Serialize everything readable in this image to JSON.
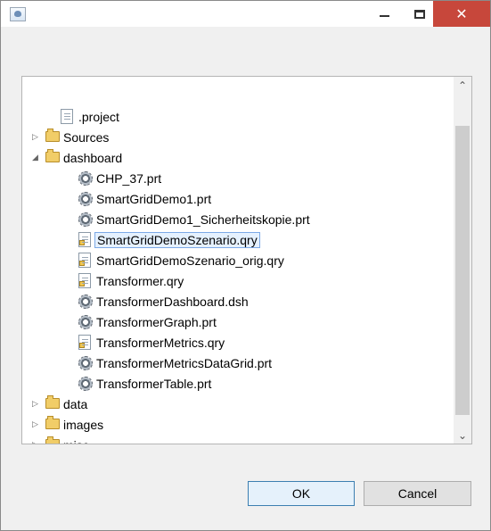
{
  "window": {
    "title": "",
    "close_glyph": "✕"
  },
  "tree": {
    "items": [
      {
        "label": ".project",
        "icon": "page-icon",
        "indent": 1,
        "has_children": false,
        "expanded": false,
        "selected": false
      },
      {
        "label": "Sources",
        "icon": "folder-icon",
        "indent": 0,
        "has_children": true,
        "expanded": false,
        "selected": false
      },
      {
        "label": "dashboard",
        "icon": "folder-icon",
        "indent": 0,
        "has_children": true,
        "expanded": true,
        "selected": false
      },
      {
        "label": "CHP_37.prt",
        "icon": "gear-icon",
        "indent": 2,
        "has_children": false,
        "expanded": false,
        "selected": false
      },
      {
        "label": "SmartGridDemo1.prt",
        "icon": "gear-icon",
        "indent": 2,
        "has_children": false,
        "expanded": false,
        "selected": false
      },
      {
        "label": "SmartGridDemo1_Sicherheitskopie.prt",
        "icon": "gear-icon",
        "indent": 2,
        "has_children": false,
        "expanded": false,
        "selected": false
      },
      {
        "label": "SmartGridDemoSzenario.qry",
        "icon": "query-icon",
        "indent": 2,
        "has_children": false,
        "expanded": false,
        "selected": true
      },
      {
        "label": "SmartGridDemoSzenario_orig.qry",
        "icon": "query-icon",
        "indent": 2,
        "has_children": false,
        "expanded": false,
        "selected": false
      },
      {
        "label": "Transformer.qry",
        "icon": "query-icon",
        "indent": 2,
        "has_children": false,
        "expanded": false,
        "selected": false
      },
      {
        "label": "TransformerDashboard.dsh",
        "icon": "gear-icon",
        "indent": 2,
        "has_children": false,
        "expanded": false,
        "selected": false
      },
      {
        "label": "TransformerGraph.prt",
        "icon": "gear-icon",
        "indent": 2,
        "has_children": false,
        "expanded": false,
        "selected": false
      },
      {
        "label": "TransformerMetrics.qry",
        "icon": "query-icon",
        "indent": 2,
        "has_children": false,
        "expanded": false,
        "selected": false
      },
      {
        "label": "TransformerMetricsDataGrid.prt",
        "icon": "gear-icon",
        "indent": 2,
        "has_children": false,
        "expanded": false,
        "selected": false
      },
      {
        "label": "TransformerTable.prt",
        "icon": "gear-icon",
        "indent": 2,
        "has_children": false,
        "expanded": false,
        "selected": false
      },
      {
        "label": "data",
        "icon": "folder-icon",
        "indent": 0,
        "has_children": true,
        "expanded": false,
        "selected": false
      },
      {
        "label": "images",
        "icon": "folder-icon",
        "indent": 0,
        "has_children": true,
        "expanded": false,
        "selected": false
      },
      {
        "label": "misc",
        "icon": "folder-icon",
        "indent": 0,
        "has_children": true,
        "expanded": false,
        "selected": false
      }
    ]
  },
  "scrollbar": {
    "up_glyph": "⌃",
    "down_glyph": "⌄"
  },
  "buttons": {
    "ok": "OK",
    "cancel": "Cancel"
  }
}
